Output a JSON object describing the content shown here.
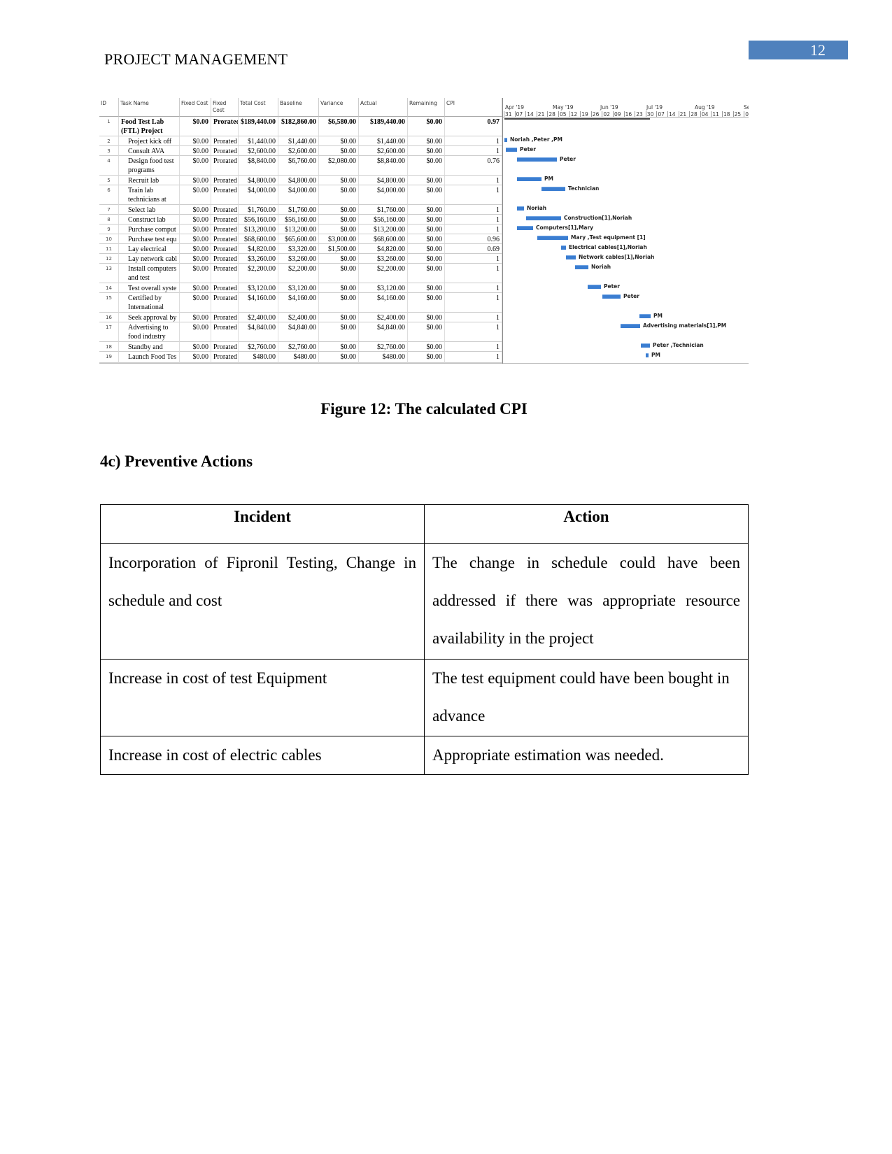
{
  "header": {
    "running_title": "PROJECT MANAGEMENT",
    "page_number": "12",
    "accent": "#4f81bd"
  },
  "project_table": {
    "columns": [
      "ID",
      "Task Name",
      "Fixed Cost",
      "Fixed Cost Accrual",
      "Total Cost",
      "Baseline",
      "Variance",
      "Actual",
      "Remaining",
      "CPI"
    ],
    "column_labels": [
      "ID",
      "Task Name",
      "Fixed Cost",
      "Fixed\nCost",
      "Total Cost",
      "Baseline",
      "Variance",
      "Actual",
      "Remaining",
      "CPI"
    ],
    "rows": [
      [
        "1",
        "Food Test Lab (FTL) Project",
        "$0.00",
        "Prorated",
        "$189,440.00",
        "$182,860.00",
        "$6,580.00",
        "$189,440.00",
        "$0.00",
        "0.97"
      ],
      [
        "2",
        "Project kick off m",
        "$0.00",
        "Prorated",
        "$1,440.00",
        "$1,440.00",
        "$0.00",
        "$1,440.00",
        "$0.00",
        "1"
      ],
      [
        "3",
        "Consult AVA",
        "$0.00",
        "Prorated",
        "$2,600.00",
        "$2,600.00",
        "$0.00",
        "$2,600.00",
        "$0.00",
        "1"
      ],
      [
        "4",
        "Design food test programs",
        "$0.00",
        "Prorated",
        "$8,840.00",
        "$6,760.00",
        "$2,080.00",
        "$8,840.00",
        "$0.00",
        "0.76"
      ],
      [
        "5",
        "Recruit lab techni",
        "$0.00",
        "Prorated",
        "$4,800.00",
        "$4,800.00",
        "$0.00",
        "$4,800.00",
        "$0.00",
        "1"
      ],
      [
        "6",
        "Train lab technicians at",
        "$0.00",
        "Prorated",
        "$4,000.00",
        "$4,000.00",
        "$0.00",
        "$4,000.00",
        "$0.00",
        "1"
      ],
      [
        "7",
        "Select lab contrac",
        "$0.00",
        "Prorated",
        "$1,760.00",
        "$1,760.00",
        "$0.00",
        "$1,760.00",
        "$0.00",
        "1"
      ],
      [
        "8",
        "Construct lab",
        "$0.00",
        "Prorated",
        "$56,160.00",
        "$56,160.00",
        "$0.00",
        "$56,160.00",
        "$0.00",
        "1"
      ],
      [
        "9",
        "Purchase comput",
        "$0.00",
        "Prorated",
        "$13,200.00",
        "$13,200.00",
        "$0.00",
        "$13,200.00",
        "$0.00",
        "1"
      ],
      [
        "10",
        "Purchase test equ",
        "$0.00",
        "Prorated",
        "$68,600.00",
        "$65,600.00",
        "$3,000.00",
        "$68,600.00",
        "$0.00",
        "0.96"
      ],
      [
        "11",
        "Lay electrical cab",
        "$0.00",
        "Prorated",
        "$4,820.00",
        "$3,320.00",
        "$1,500.00",
        "$4,820.00",
        "$0.00",
        "0.69"
      ],
      [
        "12",
        "Lay network cabl",
        "$0.00",
        "Prorated",
        "$3,260.00",
        "$3,260.00",
        "$0.00",
        "$3,260.00",
        "$0.00",
        "1"
      ],
      [
        "13",
        "Install computers and test",
        "$0.00",
        "Prorated",
        "$2,200.00",
        "$2,200.00",
        "$0.00",
        "$2,200.00",
        "$0.00",
        "1"
      ],
      [
        "14",
        "Test overall syste",
        "$0.00",
        "Prorated",
        "$3,120.00",
        "$3,120.00",
        "$0.00",
        "$3,120.00",
        "$0.00",
        "1"
      ],
      [
        "15",
        "Certified by International",
        "$0.00",
        "Prorated",
        "$4,160.00",
        "$4,160.00",
        "$0.00",
        "$4,160.00",
        "$0.00",
        "1"
      ],
      [
        "16",
        "Seek approval by",
        "$0.00",
        "Prorated",
        "$2,400.00",
        "$2,400.00",
        "$0.00",
        "$2,400.00",
        "$0.00",
        "1"
      ],
      [
        "17",
        "Advertising to food industry",
        "$0.00",
        "Prorated",
        "$4,840.00",
        "$4,840.00",
        "$0.00",
        "$4,840.00",
        "$0.00",
        "1"
      ],
      [
        "18",
        "Standby and supp",
        "$0.00",
        "Prorated",
        "$2,760.00",
        "$2,760.00",
        "$0.00",
        "$2,760.00",
        "$0.00",
        "1"
      ],
      [
        "19",
        "Launch Food Tes",
        "$0.00",
        "Prorated",
        "$480.00",
        "$480.00",
        "$0.00",
        "$480.00",
        "$0.00",
        "1"
      ]
    ]
  },
  "gantt": {
    "months": [
      "Apr '19",
      "May '19",
      "Jun '19",
      "Jul '19",
      "Aug '19",
      "Se"
    ],
    "weeks": [
      "31",
      "07",
      "14",
      "21",
      "28",
      "05",
      "12",
      "19",
      "26",
      "02",
      "09",
      "16",
      "23",
      "30",
      "07",
      "14",
      "21",
      "28",
      "04",
      "11",
      "18",
      "25",
      "0"
    ],
    "bar_color": "#3a7dd1",
    "resources": [
      "",
      "Noriah ,Peter ,PM",
      "Peter",
      "Peter",
      "PM",
      "Technician",
      "Noriah",
      "Construction[1],Noriah",
      "Computers[1],Mary",
      "Mary ,Test equipment [1]",
      "Electrical cables[1],Noriah",
      "Network cables[1],Noriah",
      "Noriah",
      "Peter",
      "Peter",
      "PM",
      "Advertising materials[1],PM",
      "Peter ,Technician",
      "PM"
    ]
  },
  "caption": "Figure 12: The calculated CPI",
  "section_heading": "4c) Preventive Actions",
  "actions_table": {
    "headers": [
      "Incident",
      "Action"
    ],
    "rows": [
      [
        "Incorporation of Fipronil Testing, Change in schedule and cost",
        "The change in schedule could have been addressed if there was appropriate resource availability in the project"
      ],
      [
        "Increase in cost of test Equipment",
        "The test equipment could have been bought in advance"
      ],
      [
        "Increase in cost of electric cables",
        "Appropriate estimation was needed."
      ]
    ]
  }
}
